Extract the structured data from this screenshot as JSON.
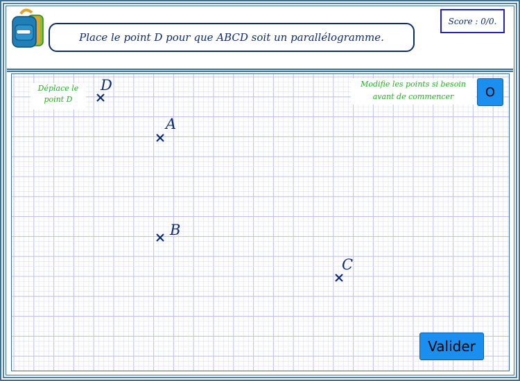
{
  "header": {
    "instruction": "Place le point D pour que ABCD soit un parallélogramme.",
    "score": "Score : 0/0."
  },
  "hints": {
    "move_line1": "Déplace le",
    "move_line2": "point D",
    "modify_line1": "Modifie les points si besoin",
    "modify_line2": "avant de commencer"
  },
  "buttons": {
    "reset_label": "O",
    "validate_label": "Valider"
  },
  "points": [
    {
      "label": "D",
      "name": "point-d"
    },
    {
      "label": "A",
      "name": "point-a"
    },
    {
      "label": "B",
      "name": "point-b"
    },
    {
      "label": "C",
      "name": "point-c"
    }
  ],
  "colors": {
    "frame": "#3a6f9c",
    "point": "#0b2a6f",
    "hint": "#22b022",
    "button": "#1a8ff0",
    "grid_minor": "#e3e3f8",
    "grid_major": "#c2c2ec"
  }
}
